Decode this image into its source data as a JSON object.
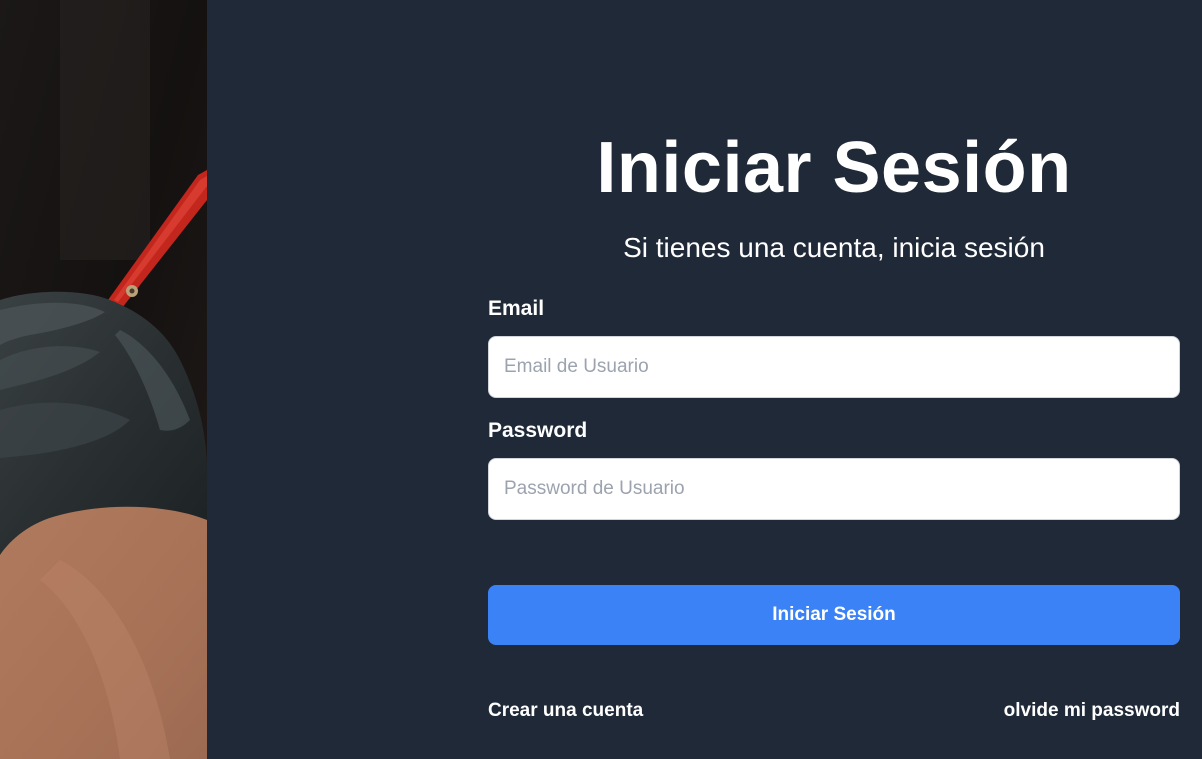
{
  "login": {
    "title": "Iniciar Sesión",
    "subtitle": "Si tienes una cuenta, inicia sesión",
    "email_label": "Email",
    "email_placeholder": "Email de Usuario",
    "email_value": "",
    "password_label": "Password",
    "password_placeholder": "Password de Usuario",
    "password_value": "",
    "submit_label": "Iniciar Sesión",
    "create_account_link": "Crear una cuenta",
    "forgot_password_link": "olvide mi password"
  },
  "colors": {
    "background": "#1f2937",
    "primary_button": "#3b82f6",
    "text": "#ffffff"
  },
  "hero_image": {
    "icon": "barber-photo"
  }
}
